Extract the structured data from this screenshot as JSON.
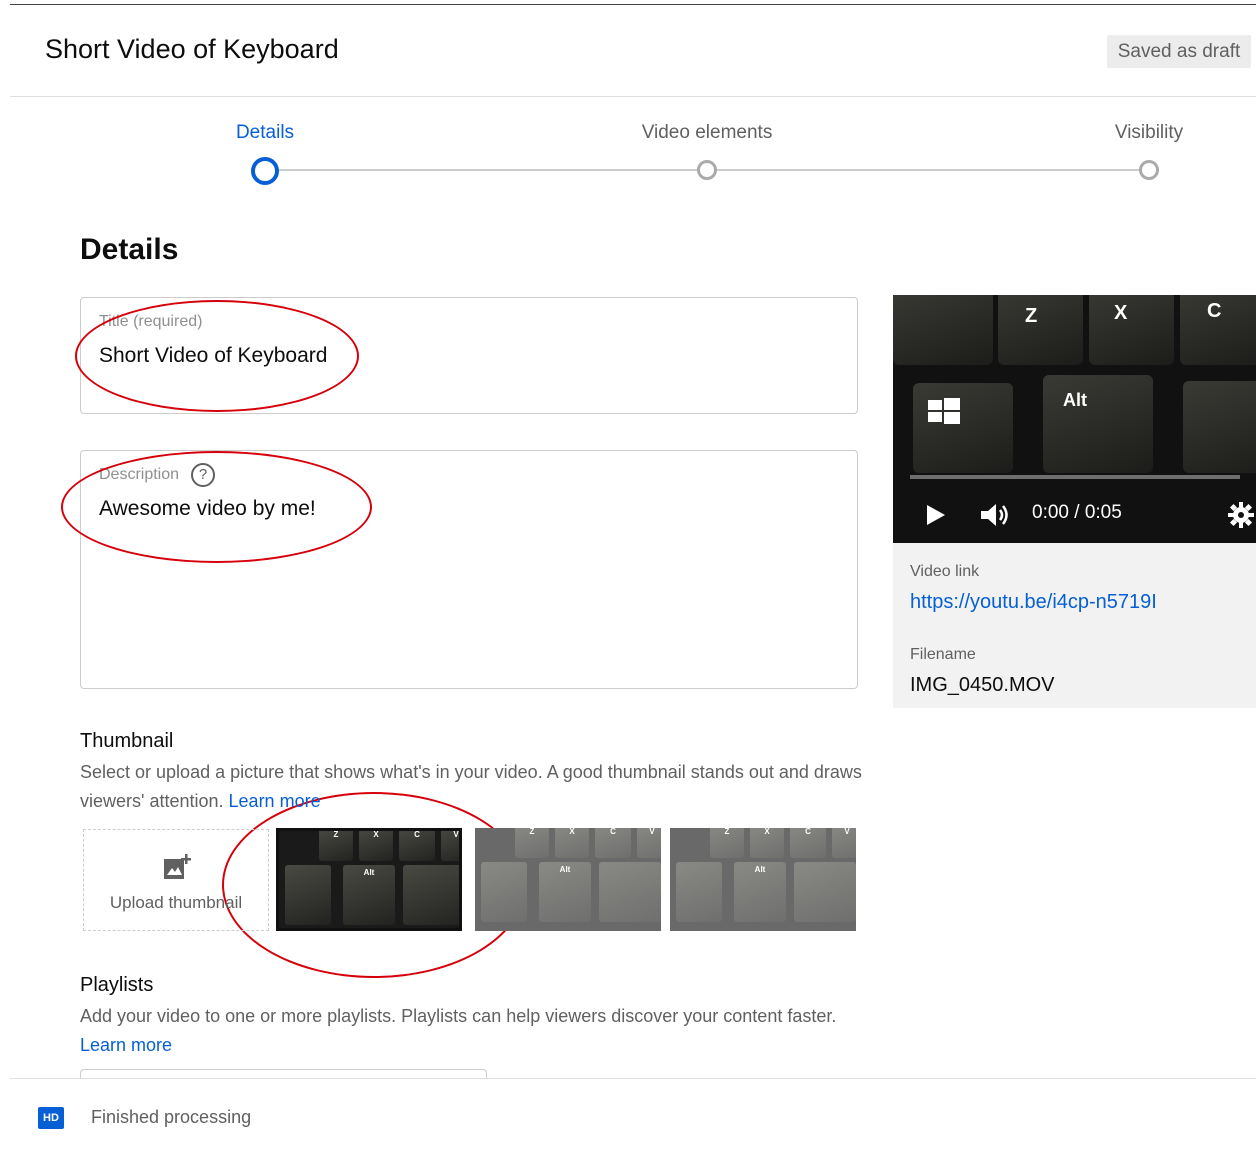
{
  "header": {
    "title": "Short Video of Keyboard",
    "draft_status": "Saved as draft"
  },
  "stepper": {
    "steps": [
      {
        "label": "Details",
        "active": true
      },
      {
        "label": "Video elements",
        "active": false
      },
      {
        "label": "Visibility",
        "active": false
      }
    ]
  },
  "details": {
    "section_title": "Details",
    "title_field": {
      "label": "Title (required)",
      "value": "Short Video of Keyboard"
    },
    "description_field": {
      "label": "Description",
      "value": "Awesome video by me!",
      "help_icon": "question-circle-icon"
    }
  },
  "player": {
    "keys": [
      "Z",
      "X",
      "C",
      "Alt"
    ],
    "time": "0:00 / 0:05",
    "progress": 0.0,
    "icons": [
      "play-icon",
      "volume-icon",
      "settings-gear-icon"
    ]
  },
  "video_info": {
    "link_label": "Video link",
    "link_url": "https://youtu.be/i4cp-n5719I",
    "filename_label": "Filename",
    "filename": "IMG_0450.MOV"
  },
  "thumbnail": {
    "heading": "Thumbnail",
    "description": "Select or upload a picture that shows what's in your video. A good thumbnail stands out and draws viewers' attention.",
    "learn_more": "Learn more",
    "upload_label": "Upload thumbnail",
    "upload_icon": "add-photo-icon",
    "options": [
      {
        "keys": [
          "Z",
          "X",
          "C",
          "V",
          "Alt"
        ],
        "selected": true
      },
      {
        "keys": [
          "Z",
          "X",
          "C",
          "V",
          "Alt"
        ],
        "selected": false
      },
      {
        "keys": [
          "Z",
          "X",
          "C",
          "V",
          "Alt"
        ],
        "selected": false
      }
    ]
  },
  "playlists": {
    "heading": "Playlists",
    "description": "Add your video to one or more playlists. Playlists can help viewers discover your content faster.",
    "learn_more": "Learn more"
  },
  "footer": {
    "badge": "HD",
    "status": "Finished processing"
  },
  "colors": {
    "accent": "#065fd4",
    "annotation": "#d6000b"
  }
}
